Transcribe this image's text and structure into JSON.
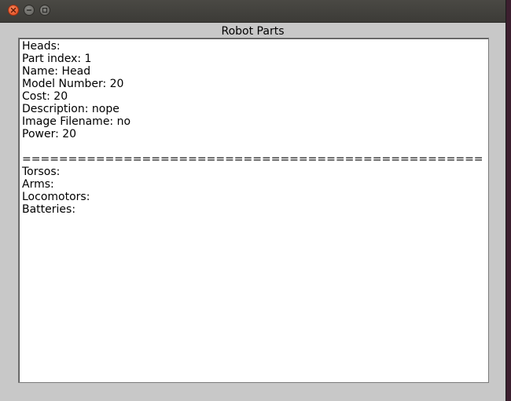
{
  "window": {
    "title": "Robot Parts",
    "buttons": {
      "close": "close-icon",
      "minimize": "minimize-icon",
      "maximize": "maximize-icon"
    }
  },
  "textarea": {
    "lines": [
      "Heads:",
      "Part index: 1",
      "Name: Head",
      "Model Number: 20",
      "Cost: 20",
      "Description: nope",
      "Image Filename: no",
      "Power: 20",
      "",
      "==================================================",
      "Torsos:",
      "Arms:",
      "Locomotors:",
      "Batteries:"
    ]
  },
  "colors": {
    "titlebar": "#3c3b37",
    "close_button": "#e0461c",
    "window_bg": "#c8c8c8",
    "text_bg": "#ffffff"
  }
}
